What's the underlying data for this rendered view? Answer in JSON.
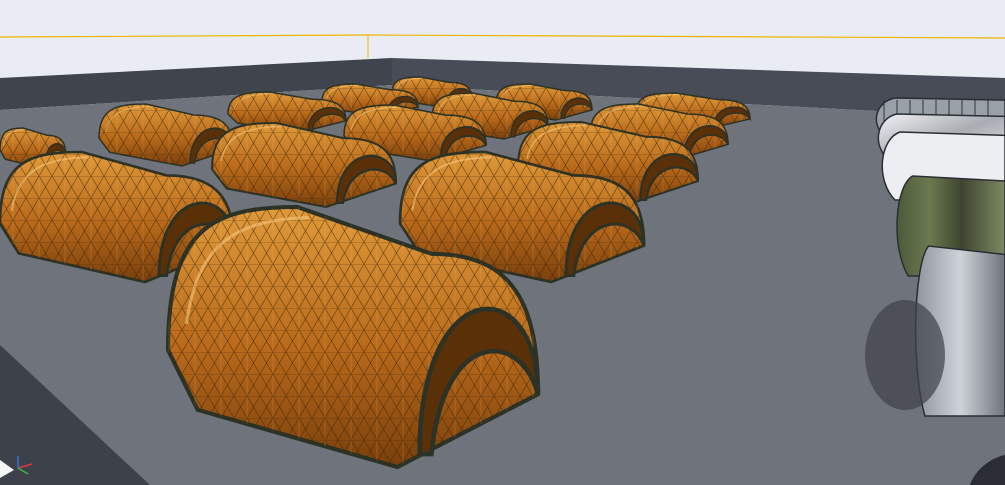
{
  "viewport": {
    "name": "level-editor-viewport",
    "sky_color": "#e9edf3",
    "floor_color": "#6f737c",
    "wall_color": "#41464f",
    "boundary_line_color": "#f0b400"
  },
  "scene": {
    "domes": [
      {
        "material": "copper-geodesic"
      },
      {
        "material": "copper-geodesic"
      },
      {
        "material": "copper-geodesic"
      },
      {
        "material": "copper-geodesic"
      },
      {
        "material": "copper-geodesic"
      },
      {
        "material": "copper-geodesic"
      },
      {
        "material": "copper-geodesic"
      },
      {
        "material": "copper-geodesic"
      },
      {
        "material": "copper-geodesic"
      },
      {
        "material": "copper-geodesic"
      },
      {
        "material": "copper-geodesic"
      },
      {
        "material": "copper-geodesic"
      },
      {
        "material": "copper-geodesic"
      },
      {
        "material": "copper-geodesic"
      },
      {
        "material": "copper-geodesic"
      }
    ],
    "side_domes": [
      {
        "material": "wire-mesh"
      },
      {
        "material": "silver-foil"
      },
      {
        "material": "white-fabric"
      },
      {
        "material": "camouflage"
      },
      {
        "material": "chrome"
      }
    ],
    "colors": {
      "copper_light": "#d18a2a",
      "copper_mid": "#a85f12",
      "copper_dark": "#5a3008",
      "frame": "#2c3326"
    }
  },
  "axis_gizmo": {
    "x_color": "#e0383c",
    "y_color": "#3bb34a",
    "z_color": "#3a6fe0"
  }
}
